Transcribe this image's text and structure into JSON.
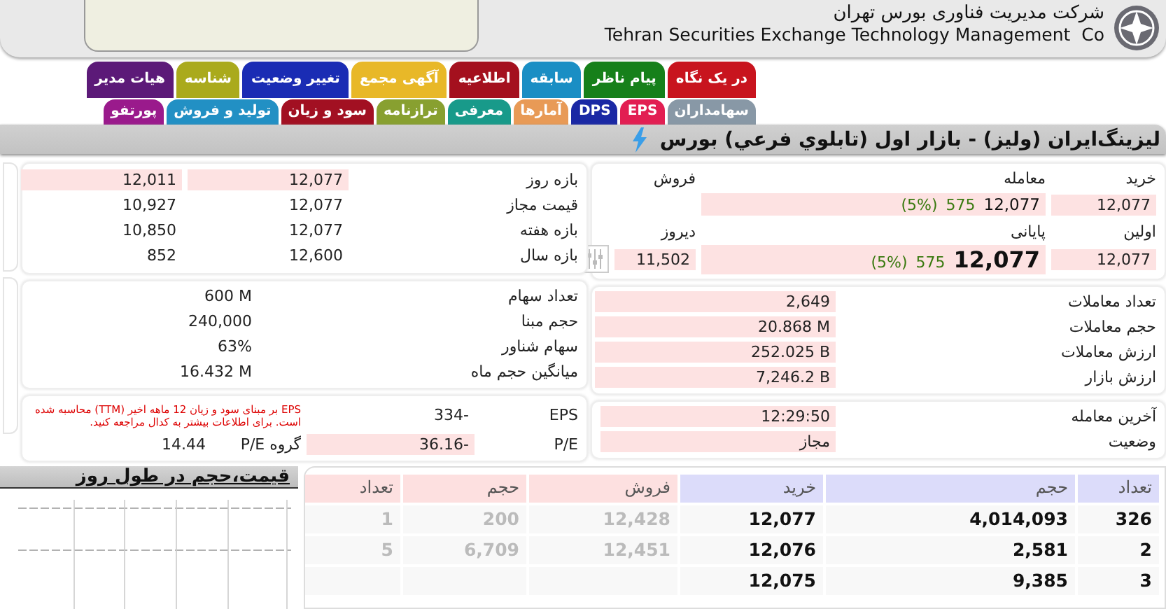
{
  "header": {
    "company_fa": "شرکت مدیریت فناوری بورس تهران",
    "company_en": "Tehran Securities Exchange Technology Management  Co"
  },
  "tabs_row1": [
    {
      "label": "در یک نگاه",
      "color": "#c8141e"
    },
    {
      "label": "پیام ناظر",
      "color": "#16801a"
    },
    {
      "label": "سابقه",
      "color": "#1a8ec4"
    },
    {
      "label": "اطلاعیه",
      "color": "#a4101e"
    },
    {
      "label": "آگهی مجمع",
      "color": "#e8b828"
    },
    {
      "label": "تغییر وضعیت",
      "color": "#1a2cb4"
    },
    {
      "label": "شناسه",
      "color": "#aaaa1c"
    },
    {
      "label": "هیات مدیر",
      "color": "#5c1a78"
    }
  ],
  "tabs_row2": [
    {
      "label": "سهامداران",
      "color": "#8898a6"
    },
    {
      "label": "EPS",
      "color": "#e21e52"
    },
    {
      "label": "DPS",
      "color": "#1a28a4"
    },
    {
      "label": "آمارها",
      "color": "#e89a56"
    },
    {
      "label": "معرفی",
      "color": "#189a8a"
    },
    {
      "label": "ترازنامه",
      "color": "#88a030"
    },
    {
      "label": "سود و زیان",
      "color": "#a21022"
    },
    {
      "label": "تولید و فروش",
      "color": "#2290c4"
    },
    {
      "label": "پورتفو",
      "color": "#9a1a8c"
    }
  ],
  "title": "لیزینگ‌ایران (ولیز) - بازار اول (تابلوي فرعي) بورس",
  "trade": {
    "buy_label": "خرید",
    "buy": "12,077",
    "deal_label": "معامله",
    "deal": "12,077",
    "deal_change": "575",
    "deal_percent": "(5%)",
    "sell_label": "فروش",
    "first_label": "اولین",
    "first": "12,077",
    "close_label": "پایانی",
    "close": "12,077",
    "close_change": "575",
    "close_percent": "(5%)",
    "yesterday_label": "دیروز",
    "yesterday": "11,502"
  },
  "ranges": [
    {
      "label": "بازه روز",
      "high": "12,077",
      "low": "12,011",
      "highlighted": true
    },
    {
      "label": "قیمت مجاز",
      "high": "12,077",
      "low": "10,927",
      "highlighted": false
    },
    {
      "label": "بازه هفته",
      "high": "12,077",
      "low": "10,850",
      "highlighted": false
    },
    {
      "label": "بازه سال",
      "high": "12,600",
      "low": "852",
      "highlighted": false
    }
  ],
  "stats": [
    {
      "label": "تعداد معاملات",
      "value": "2,649"
    },
    {
      "label": "حجم معاملات",
      "value": "20.868 M"
    },
    {
      "label": "ارزش معاملات",
      "value": "252.025 B"
    },
    {
      "label": "ارزش بازار",
      "value": "7,246.2 B"
    }
  ],
  "share_info": [
    {
      "label": "تعداد سهام",
      "value": "600 M"
    },
    {
      "label": "حجم مبنا",
      "value": "240,000"
    },
    {
      "label": "سهام شناور",
      "value": "63%"
    },
    {
      "label": "میانگین حجم ماه",
      "value": "16.432 M"
    }
  ],
  "status": [
    {
      "label": "آخرین معامله",
      "value": "12:29:50"
    },
    {
      "label": "وضعیت",
      "value": "مجاز"
    }
  ],
  "eps": {
    "eps_label": "EPS",
    "eps": "334-",
    "note": "EPS بر مبنای سود و زیان 12 ماهه اخیر (TTM) محاسبه شده است. برای اطلاعات بیشتر به کدال مراجعه کنید.",
    "pe_label": "P/E",
    "pe": "36.16-",
    "group_pe_label": "گروه P/E",
    "group_pe": "14.44"
  },
  "chart": {
    "title": "قیمت،حجم در طول روز"
  },
  "order_book": {
    "buy_headers": [
      "تعداد",
      "حجم",
      "خرید"
    ],
    "sell_headers": [
      "فروش",
      "حجم",
      "تعداد"
    ],
    "buy_orders": [
      {
        "count": "326",
        "volume": "4,014,093",
        "price": "12,077"
      },
      {
        "count": "2",
        "volume": "2,581",
        "price": "12,076"
      },
      {
        "count": "3",
        "volume": "9,385",
        "price": "12,075"
      }
    ],
    "sell_orders": [
      {
        "price": "12,428",
        "volume": "200",
        "count": "1"
      },
      {
        "price": "12,451",
        "volume": "6,709",
        "count": "5"
      }
    ]
  }
}
